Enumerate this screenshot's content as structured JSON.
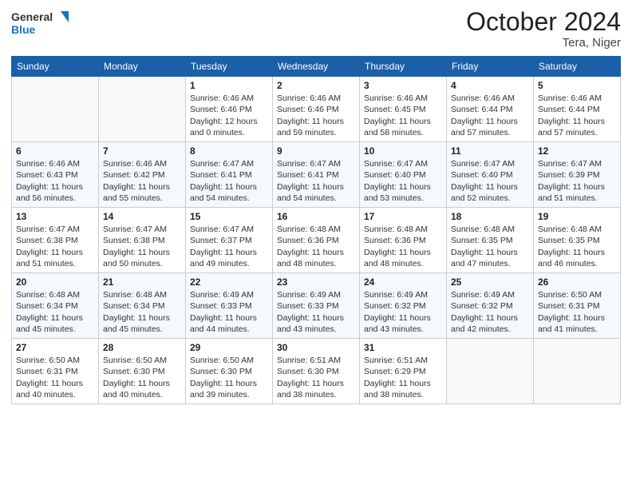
{
  "header": {
    "logo_line1": "General",
    "logo_line2": "Blue",
    "month": "October 2024",
    "location": "Tera, Niger"
  },
  "weekdays": [
    "Sunday",
    "Monday",
    "Tuesday",
    "Wednesday",
    "Thursday",
    "Friday",
    "Saturday"
  ],
  "weeks": [
    [
      {
        "day": "",
        "sunrise": "",
        "sunset": "",
        "daylight": ""
      },
      {
        "day": "",
        "sunrise": "",
        "sunset": "",
        "daylight": ""
      },
      {
        "day": "1",
        "sunrise": "Sunrise: 6:46 AM",
        "sunset": "Sunset: 6:46 PM",
        "daylight": "Daylight: 12 hours and 0 minutes."
      },
      {
        "day": "2",
        "sunrise": "Sunrise: 6:46 AM",
        "sunset": "Sunset: 6:46 PM",
        "daylight": "Daylight: 11 hours and 59 minutes."
      },
      {
        "day": "3",
        "sunrise": "Sunrise: 6:46 AM",
        "sunset": "Sunset: 6:45 PM",
        "daylight": "Daylight: 11 hours and 58 minutes."
      },
      {
        "day": "4",
        "sunrise": "Sunrise: 6:46 AM",
        "sunset": "Sunset: 6:44 PM",
        "daylight": "Daylight: 11 hours and 57 minutes."
      },
      {
        "day": "5",
        "sunrise": "Sunrise: 6:46 AM",
        "sunset": "Sunset: 6:44 PM",
        "daylight": "Daylight: 11 hours and 57 minutes."
      }
    ],
    [
      {
        "day": "6",
        "sunrise": "Sunrise: 6:46 AM",
        "sunset": "Sunset: 6:43 PM",
        "daylight": "Daylight: 11 hours and 56 minutes."
      },
      {
        "day": "7",
        "sunrise": "Sunrise: 6:46 AM",
        "sunset": "Sunset: 6:42 PM",
        "daylight": "Daylight: 11 hours and 55 minutes."
      },
      {
        "day": "8",
        "sunrise": "Sunrise: 6:47 AM",
        "sunset": "Sunset: 6:41 PM",
        "daylight": "Daylight: 11 hours and 54 minutes."
      },
      {
        "day": "9",
        "sunrise": "Sunrise: 6:47 AM",
        "sunset": "Sunset: 6:41 PM",
        "daylight": "Daylight: 11 hours and 54 minutes."
      },
      {
        "day": "10",
        "sunrise": "Sunrise: 6:47 AM",
        "sunset": "Sunset: 6:40 PM",
        "daylight": "Daylight: 11 hours and 53 minutes."
      },
      {
        "day": "11",
        "sunrise": "Sunrise: 6:47 AM",
        "sunset": "Sunset: 6:40 PM",
        "daylight": "Daylight: 11 hours and 52 minutes."
      },
      {
        "day": "12",
        "sunrise": "Sunrise: 6:47 AM",
        "sunset": "Sunset: 6:39 PM",
        "daylight": "Daylight: 11 hours and 51 minutes."
      }
    ],
    [
      {
        "day": "13",
        "sunrise": "Sunrise: 6:47 AM",
        "sunset": "Sunset: 6:38 PM",
        "daylight": "Daylight: 11 hours and 51 minutes."
      },
      {
        "day": "14",
        "sunrise": "Sunrise: 6:47 AM",
        "sunset": "Sunset: 6:38 PM",
        "daylight": "Daylight: 11 hours and 50 minutes."
      },
      {
        "day": "15",
        "sunrise": "Sunrise: 6:47 AM",
        "sunset": "Sunset: 6:37 PM",
        "daylight": "Daylight: 11 hours and 49 minutes."
      },
      {
        "day": "16",
        "sunrise": "Sunrise: 6:48 AM",
        "sunset": "Sunset: 6:36 PM",
        "daylight": "Daylight: 11 hours and 48 minutes."
      },
      {
        "day": "17",
        "sunrise": "Sunrise: 6:48 AM",
        "sunset": "Sunset: 6:36 PM",
        "daylight": "Daylight: 11 hours and 48 minutes."
      },
      {
        "day": "18",
        "sunrise": "Sunrise: 6:48 AM",
        "sunset": "Sunset: 6:35 PM",
        "daylight": "Daylight: 11 hours and 47 minutes."
      },
      {
        "day": "19",
        "sunrise": "Sunrise: 6:48 AM",
        "sunset": "Sunset: 6:35 PM",
        "daylight": "Daylight: 11 hours and 46 minutes."
      }
    ],
    [
      {
        "day": "20",
        "sunrise": "Sunrise: 6:48 AM",
        "sunset": "Sunset: 6:34 PM",
        "daylight": "Daylight: 11 hours and 45 minutes."
      },
      {
        "day": "21",
        "sunrise": "Sunrise: 6:48 AM",
        "sunset": "Sunset: 6:34 PM",
        "daylight": "Daylight: 11 hours and 45 minutes."
      },
      {
        "day": "22",
        "sunrise": "Sunrise: 6:49 AM",
        "sunset": "Sunset: 6:33 PM",
        "daylight": "Daylight: 11 hours and 44 minutes."
      },
      {
        "day": "23",
        "sunrise": "Sunrise: 6:49 AM",
        "sunset": "Sunset: 6:33 PM",
        "daylight": "Daylight: 11 hours and 43 minutes."
      },
      {
        "day": "24",
        "sunrise": "Sunrise: 6:49 AM",
        "sunset": "Sunset: 6:32 PM",
        "daylight": "Daylight: 11 hours and 43 minutes."
      },
      {
        "day": "25",
        "sunrise": "Sunrise: 6:49 AM",
        "sunset": "Sunset: 6:32 PM",
        "daylight": "Daylight: 11 hours and 42 minutes."
      },
      {
        "day": "26",
        "sunrise": "Sunrise: 6:50 AM",
        "sunset": "Sunset: 6:31 PM",
        "daylight": "Daylight: 11 hours and 41 minutes."
      }
    ],
    [
      {
        "day": "27",
        "sunrise": "Sunrise: 6:50 AM",
        "sunset": "Sunset: 6:31 PM",
        "daylight": "Daylight: 11 hours and 40 minutes."
      },
      {
        "day": "28",
        "sunrise": "Sunrise: 6:50 AM",
        "sunset": "Sunset: 6:30 PM",
        "daylight": "Daylight: 11 hours and 40 minutes."
      },
      {
        "day": "29",
        "sunrise": "Sunrise: 6:50 AM",
        "sunset": "Sunset: 6:30 PM",
        "daylight": "Daylight: 11 hours and 39 minutes."
      },
      {
        "day": "30",
        "sunrise": "Sunrise: 6:51 AM",
        "sunset": "Sunset: 6:30 PM",
        "daylight": "Daylight: 11 hours and 38 minutes."
      },
      {
        "day": "31",
        "sunrise": "Sunrise: 6:51 AM",
        "sunset": "Sunset: 6:29 PM",
        "daylight": "Daylight: 11 hours and 38 minutes."
      },
      {
        "day": "",
        "sunrise": "",
        "sunset": "",
        "daylight": ""
      },
      {
        "day": "",
        "sunrise": "",
        "sunset": "",
        "daylight": ""
      }
    ]
  ]
}
